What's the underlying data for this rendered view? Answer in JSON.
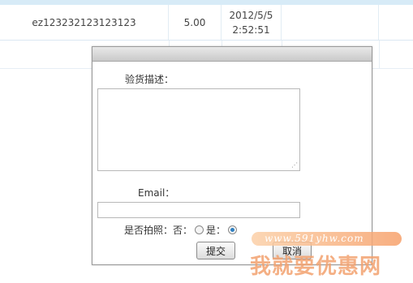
{
  "table": {
    "row1": {
      "order_id": "ez123232123123123",
      "amount": "5.00",
      "date": "2012/5/5",
      "time": "2:52:51"
    }
  },
  "dialog": {
    "description_label": "验货描述：",
    "description_value": "",
    "email_label": "Email：",
    "email_value": "",
    "photo_label": "是否拍照：",
    "option_no": "否：",
    "option_yes": "是：",
    "photo_selected": "是",
    "submit_label": "提交",
    "cancel_label": "取消"
  },
  "watermark": {
    "url": "www.591yhw.com",
    "text": "我就要优惠网"
  }
}
